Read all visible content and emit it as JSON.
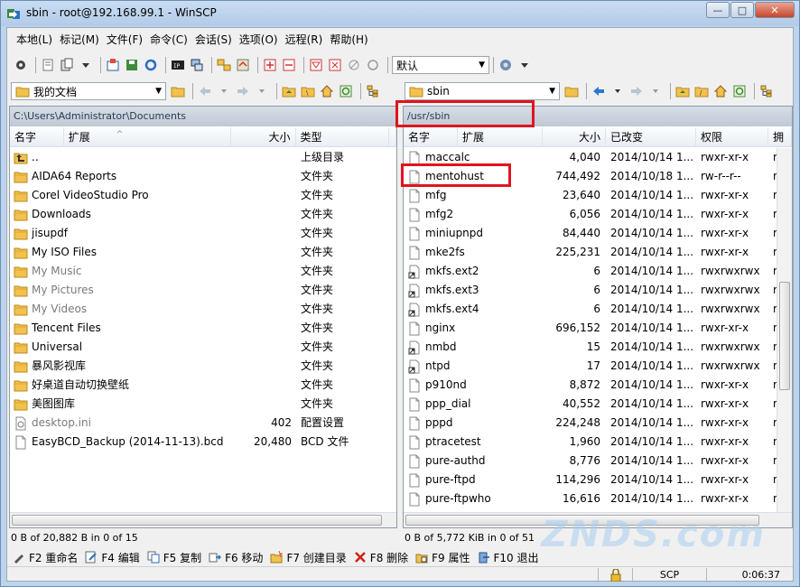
{
  "window": {
    "title": "sbin - root@192.168.99.1 - WinSCP",
    "buttons": {
      "minimize": "—",
      "maximize": "□",
      "close": "✕"
    }
  },
  "menu": [
    "本地(L)",
    "标记(M)",
    "文件(F)",
    "命令(C)",
    "会话(S)",
    "选项(O)",
    "远程(R)",
    "帮助(H)"
  ],
  "toolbar": {
    "transfer_setting": "默认"
  },
  "left": {
    "path_combo": "我的文档",
    "path": "C:\\Users\\Administrator\\Documents",
    "columns": {
      "name": "名字",
      "ext": "扩展",
      "size": "大小",
      "type": "类型"
    },
    "files": [
      {
        "name": "..",
        "size": "",
        "type": "上级目录",
        "icon": "parent-dir-icon",
        "dim": false
      },
      {
        "name": "AIDA64 Reports",
        "size": "",
        "type": "文件夹",
        "icon": "folder-icon",
        "dim": false
      },
      {
        "name": "Corel VideoStudio Pro",
        "size": "",
        "type": "文件夹",
        "icon": "folder-icon",
        "dim": false
      },
      {
        "name": "Downloads",
        "size": "",
        "type": "文件夹",
        "icon": "folder-icon",
        "dim": false
      },
      {
        "name": "jisupdf",
        "size": "",
        "type": "文件夹",
        "icon": "folder-icon",
        "dim": false
      },
      {
        "name": "My ISO Files",
        "size": "",
        "type": "文件夹",
        "icon": "folder-icon",
        "dim": false
      },
      {
        "name": "My Music",
        "size": "",
        "type": "文件夹",
        "icon": "folder-icon",
        "dim": true
      },
      {
        "name": "My Pictures",
        "size": "",
        "type": "文件夹",
        "icon": "folder-icon",
        "dim": true
      },
      {
        "name": "My Videos",
        "size": "",
        "type": "文件夹",
        "icon": "folder-icon",
        "dim": true
      },
      {
        "name": "Tencent Files",
        "size": "",
        "type": "文件夹",
        "icon": "folder-icon",
        "dim": false
      },
      {
        "name": "Universal",
        "size": "",
        "type": "文件夹",
        "icon": "folder-icon",
        "dim": false
      },
      {
        "name": "暴风影视库",
        "size": "",
        "type": "文件夹",
        "icon": "folder-icon",
        "dim": false
      },
      {
        "name": "好桌道自动切换壁纸",
        "size": "",
        "type": "文件夹",
        "icon": "folder-icon",
        "dim": false
      },
      {
        "name": "美图图库",
        "size": "",
        "type": "文件夹",
        "icon": "folder-icon",
        "dim": false
      },
      {
        "name": "desktop.ini",
        "size": "402",
        "type": "配置设置",
        "icon": "ini-file-icon",
        "dim": true
      },
      {
        "name": "EasyBCD_Backup (2014-11-13).bcd",
        "size": "20,480",
        "type": "BCD 文件",
        "icon": "file-icon",
        "dim": false
      }
    ],
    "status": "0 B of 20,882 B in 0 of 15"
  },
  "right": {
    "path_combo": "sbin",
    "path": "/usr/sbin",
    "columns": {
      "name": "名字",
      "ext": "扩展",
      "size": "大小",
      "changed": "已改变",
      "rights": "权限",
      "owner": "拥"
    },
    "files": [
      {
        "name": "maccalc",
        "size": "4,040",
        "changed": "2014/10/14 1...",
        "rights": "rwxr-xr-x",
        "owner": "r",
        "icon": "file-icon"
      },
      {
        "name": "mentohust",
        "size": "744,492",
        "changed": "2014/10/18 1...",
        "rights": "rw-r--r--",
        "owner": "r",
        "icon": "file-icon"
      },
      {
        "name": "mfg",
        "size": "23,640",
        "changed": "2014/10/14 1...",
        "rights": "rwxr-xr-x",
        "owner": "r",
        "icon": "file-icon"
      },
      {
        "name": "mfg2",
        "size": "6,056",
        "changed": "2014/10/14 1...",
        "rights": "rwxr-xr-x",
        "owner": "r",
        "icon": "file-icon"
      },
      {
        "name": "miniupnpd",
        "size": "84,440",
        "changed": "2014/10/14 1...",
        "rights": "rwxr-xr-x",
        "owner": "r",
        "icon": "file-icon"
      },
      {
        "name": "mke2fs",
        "size": "225,231",
        "changed": "2014/10/14 1...",
        "rights": "rwxr-xr-x",
        "owner": "r",
        "icon": "file-icon"
      },
      {
        "name": "mkfs.ext2",
        "size": "6",
        "changed": "2014/10/14 1...",
        "rights": "rwxrwxrwx",
        "owner": "r",
        "icon": "link-file-icon"
      },
      {
        "name": "mkfs.ext3",
        "size": "6",
        "changed": "2014/10/14 1...",
        "rights": "rwxrwxrwx",
        "owner": "r",
        "icon": "link-file-icon"
      },
      {
        "name": "mkfs.ext4",
        "size": "6",
        "changed": "2014/10/14 1...",
        "rights": "rwxrwxrwx",
        "owner": "r",
        "icon": "link-file-icon"
      },
      {
        "name": "nginx",
        "size": "696,152",
        "changed": "2014/10/14 1...",
        "rights": "rwxr-xr-x",
        "owner": "r",
        "icon": "file-icon"
      },
      {
        "name": "nmbd",
        "size": "15",
        "changed": "2014/10/14 1...",
        "rights": "rwxrwxrwx",
        "owner": "r",
        "icon": "link-file-icon"
      },
      {
        "name": "ntpd",
        "size": "17",
        "changed": "2014/10/14 1...",
        "rights": "rwxrwxrwx",
        "owner": "r",
        "icon": "link-file-icon"
      },
      {
        "name": "p910nd",
        "size": "8,872",
        "changed": "2014/10/14 1...",
        "rights": "rwxr-xr-x",
        "owner": "r",
        "icon": "file-icon"
      },
      {
        "name": "ppp_dial",
        "size": "40,552",
        "changed": "2014/10/14 1...",
        "rights": "rwxr-xr-x",
        "owner": "r",
        "icon": "file-icon"
      },
      {
        "name": "pppd",
        "size": "224,248",
        "changed": "2014/10/14 1...",
        "rights": "rwxr-xr-x",
        "owner": "r",
        "icon": "file-icon"
      },
      {
        "name": "ptracetest",
        "size": "1,960",
        "changed": "2014/10/14 1...",
        "rights": "rwxr-xr-x",
        "owner": "r",
        "icon": "file-icon"
      },
      {
        "name": "pure-authd",
        "size": "8,776",
        "changed": "2014/10/14 1...",
        "rights": "rwxr-xr-x",
        "owner": "r",
        "icon": "file-icon"
      },
      {
        "name": "pure-ftpd",
        "size": "114,296",
        "changed": "2014/10/14 1...",
        "rights": "rwxr-xr-x",
        "owner": "r",
        "icon": "file-icon"
      },
      {
        "name": "pure-ftpwho",
        "size": "16,616",
        "changed": "2014/10/14 1...",
        "rights": "rwxr-xr-x",
        "owner": "r",
        "icon": "file-icon"
      }
    ],
    "status": "0 B of 5,772 KiB in 0 of 51"
  },
  "fkeys": [
    {
      "label": "F2 重命名",
      "icon": "rename-icon"
    },
    {
      "label": "F4 编辑",
      "icon": "edit-icon"
    },
    {
      "label": "F5 复制",
      "icon": "copy-icon"
    },
    {
      "label": "F6 移动",
      "icon": "move-icon"
    },
    {
      "label": "F7 创建目录",
      "icon": "new-folder-icon"
    },
    {
      "label": "F8 删除",
      "icon": "delete-icon"
    },
    {
      "label": "F9 属性",
      "icon": "properties-icon"
    },
    {
      "label": "F10 退出",
      "icon": "exit-icon"
    }
  ],
  "statusbar": {
    "protocol": "SCP",
    "time": "0:06:37"
  },
  "watermark": "ZNDS.com",
  "colors": {
    "highlight": "#e0141e",
    "folder": "#f2c14e"
  }
}
